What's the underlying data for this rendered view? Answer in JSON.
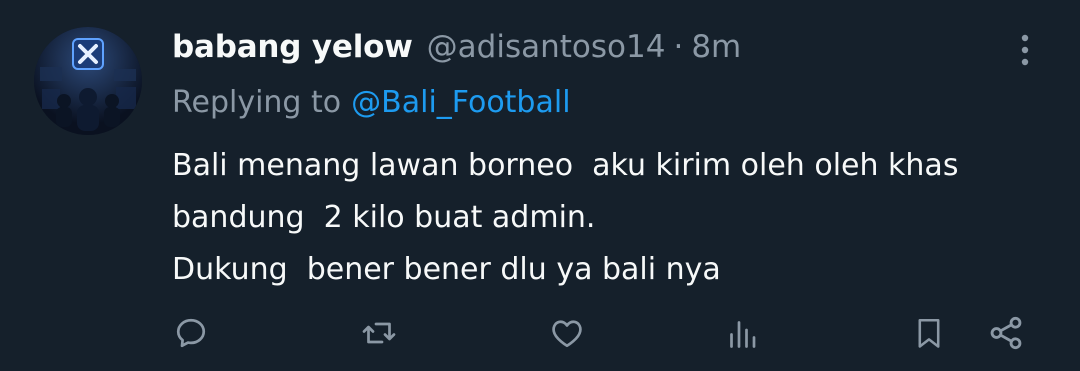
{
  "tweet": {
    "display_name": "babang yelow",
    "handle": "@adisantoso14",
    "separator": "·",
    "time": "8m",
    "replying_label": "Replying to",
    "replying_handle": "@Bali_Football",
    "body_lines": [
      "Bali menang lawan borneo  aku kirim oleh oleh khas",
      "bandung  2 kilo buat admin.",
      "Dukung  bener bener dlu ya bali nya"
    ]
  },
  "avatar": {
    "icon": "x-logo-icon"
  },
  "actions": [
    {
      "name": "reply",
      "icon": "reply-icon"
    },
    {
      "name": "retweet",
      "icon": "retweet-icon"
    },
    {
      "name": "like",
      "icon": "heart-icon"
    },
    {
      "name": "views",
      "icon": "analytics-icon"
    },
    {
      "name": "bookmark",
      "icon": "bookmark-icon"
    },
    {
      "name": "share",
      "icon": "share-icon"
    }
  ],
  "colors": {
    "background": "#15202b",
    "primary_text": "#f7f9f9",
    "secondary_text": "#8b98a5",
    "link": "#1d9bf0"
  }
}
